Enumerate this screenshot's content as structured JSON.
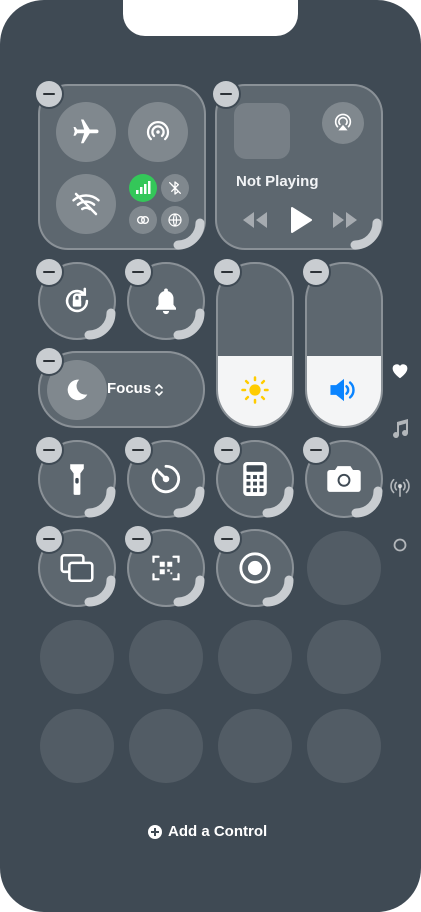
{
  "media": {
    "status": "Not Playing"
  },
  "focus": {
    "label": "Focus"
  },
  "sliders": {
    "brightness_level": 0.43,
    "volume_level": 0.43
  },
  "footer": {
    "add_control_label": "Add a Control"
  },
  "pages": [
    "heart-icon",
    "music-note-icon",
    "antenna-icon",
    "circle-icon"
  ],
  "colors": {
    "background": "#3f4a54",
    "active_green": "#34c759",
    "brightness_yellow": "#ffcc00",
    "volume_blue": "#0a84ff"
  }
}
